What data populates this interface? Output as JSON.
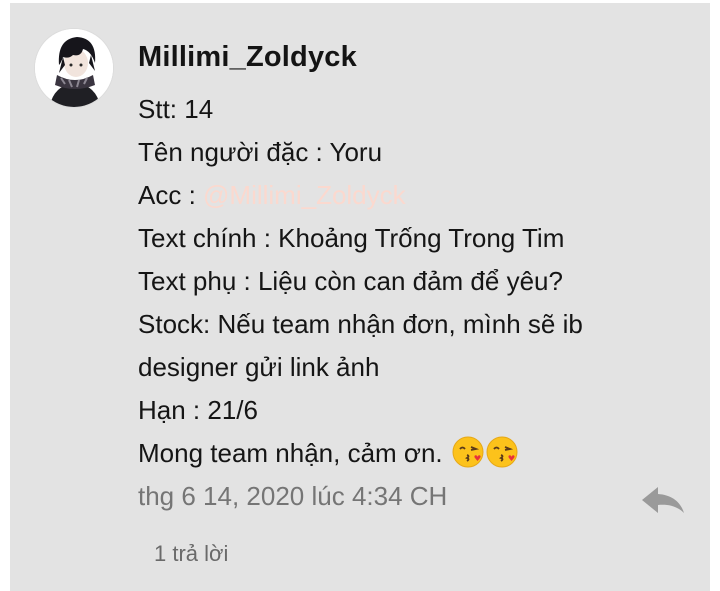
{
  "comment": {
    "username": "Millimi_Zoldyck",
    "lines": {
      "stt": "Stt: 14",
      "ten": "Tên người đặc : Yoru",
      "acc_label": "Acc : ",
      "acc_mention": "@Millimi_Zoldyck",
      "text_chinh": "Text chính : Khoảng Trống Trong Tim",
      "text_phu": "Text phụ : Liệu còn can đảm để yêu?",
      "stock_1": "Stock: Nếu team nhận đơn, mình sẽ ib",
      "stock_2": "designer gửi link ảnh",
      "han": "Hạn : 21/6",
      "closing": "Mong team nhận, cảm ơn. "
    },
    "emojis": [
      "face-blowing-kiss-icon",
      "face-blowing-kiss-icon"
    ],
    "timestamp": "thg 6 14, 2020 lúc 4:34 CH",
    "replies_label": "1 trả lời",
    "colors": {
      "card_bg": "#e3e3e3",
      "mention": "#fbd9cf",
      "meta_text": "#757575",
      "reply_icon": "#9a9a9a"
    }
  }
}
